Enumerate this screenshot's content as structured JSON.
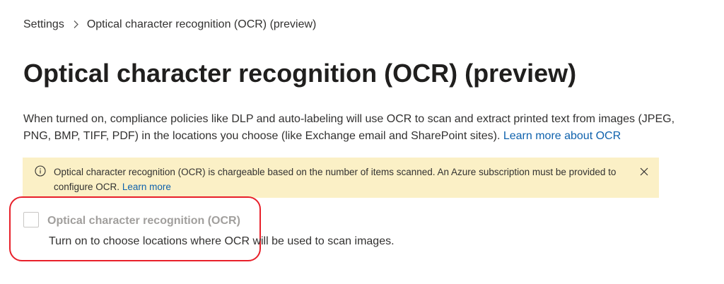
{
  "breadcrumb": {
    "root": "Settings",
    "separator": ">",
    "current": "Optical character recognition (OCR) (preview)"
  },
  "page": {
    "title": "Optical character recognition (OCR) (preview)"
  },
  "description": {
    "text": "When turned on, compliance policies like DLP and auto-labeling will use OCR to scan and extract printed text from images (JPEG, PNG, BMP, TIFF, PDF) in the locations you choose (like Exchange email and SharePoint sites).",
    "link": "Learn more about OCR"
  },
  "banner": {
    "icon": "info-icon",
    "message": "Optical character recognition (OCR) is chargeable based on the number of items scanned. An Azure subscription must be provided to configure OCR.",
    "link": "Learn more",
    "close_icon": "close-icon",
    "background_color": "#fbf0c6"
  },
  "ocr_toggle": {
    "label": "Optical character recognition (OCR)",
    "checked": false,
    "disabled": true,
    "description": "Turn on to choose locations where OCR will be used to scan images."
  },
  "colors": {
    "link": "#0f62ad",
    "highlight_annotation": "#e8202a",
    "disabled_text": "#a19f9d"
  }
}
